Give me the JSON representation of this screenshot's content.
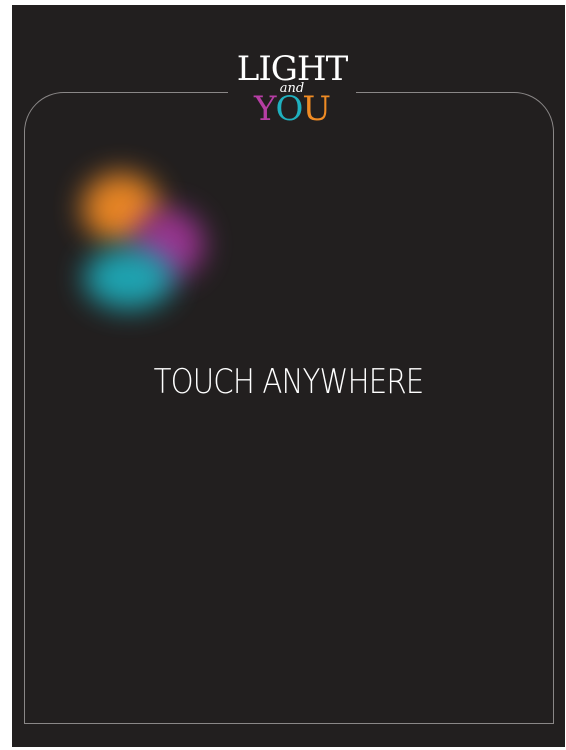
{
  "logo": {
    "line1": "LIGHT",
    "line2": "and",
    "line3_letters": [
      "Y",
      "O",
      "U"
    ],
    "colors": {
      "y": "#b63ea4",
      "o": "#1fb0be",
      "u": "#ef8b24"
    }
  },
  "prompt": {
    "text": "TOUCH ANYWHERE"
  },
  "colors": {
    "background": "#221f1f",
    "frame_border": "#8a8787",
    "text": "#ffffff",
    "blob_orange": "#f08a25",
    "blob_purple": "#a4369a",
    "blob_teal": "#1eaab8"
  }
}
